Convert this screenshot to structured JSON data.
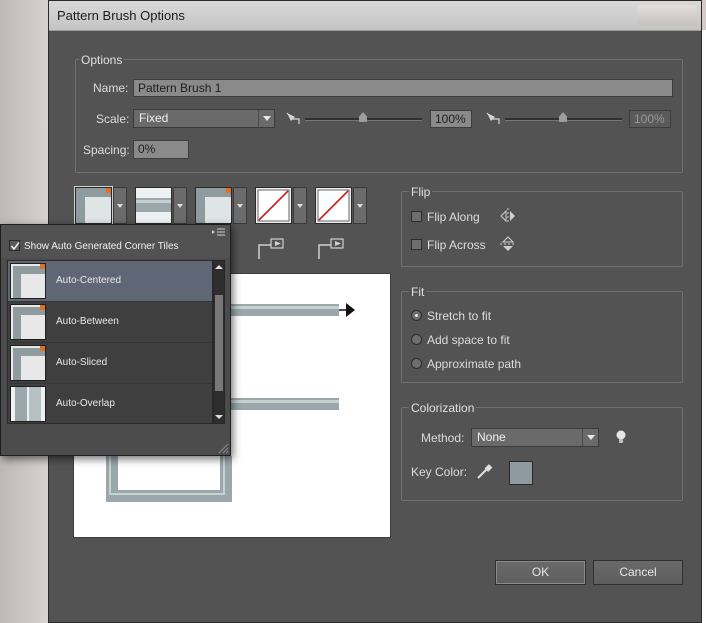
{
  "window": {
    "title": "Pattern Brush Options"
  },
  "options": {
    "group_title": "Options",
    "name_label": "Name:",
    "name_value": "Pattern Brush 1",
    "scale_label": "Scale:",
    "scale_value": "Fixed",
    "scale_min_value": "100%",
    "scale_max_value": "100%",
    "spacing_label": "Spacing:",
    "spacing_value": "0%"
  },
  "flip": {
    "group_title": "Flip",
    "flip_along": "Flip Along",
    "flip_across": "Flip Across"
  },
  "fit": {
    "group_title": "Fit",
    "stretch": "Stretch to fit",
    "add_space": "Add space to fit",
    "approximate": "Approximate path",
    "selected": "stretch"
  },
  "colorization": {
    "group_title": "Colorization",
    "method_label": "Method:",
    "method_value": "None",
    "key_color_label": "Key Color:",
    "key_color": "#8e9aa0"
  },
  "buttons": {
    "ok": "OK",
    "cancel": "Cancel"
  },
  "corner_popup": {
    "checkbox_label": "Show Auto Generated Corner Tiles",
    "checked": true,
    "items": [
      {
        "label": "Auto-Centered",
        "selected": true
      },
      {
        "label": "Auto-Between",
        "selected": false
      },
      {
        "label": "Auto-Sliced",
        "selected": false
      },
      {
        "label": "Auto-Overlap",
        "selected": false
      }
    ]
  },
  "colors": {
    "dialog_bg": "#535353",
    "tile_rail": "#9aa8ab",
    "tile_orange": "#e07020",
    "none_slash": "#cc1f1f",
    "selection": "#5f6776"
  }
}
